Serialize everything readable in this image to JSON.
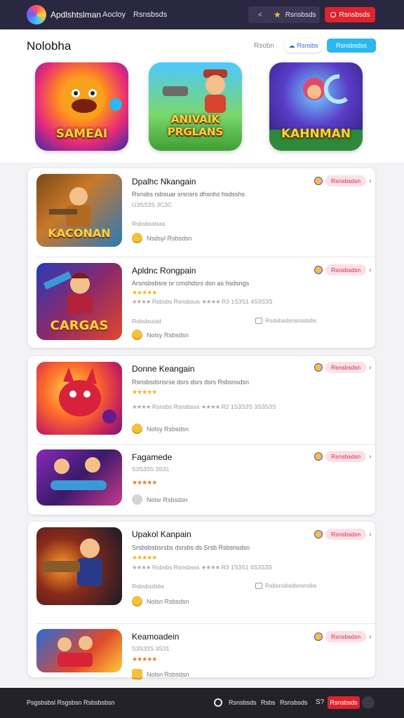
{
  "topbar": {
    "brand": "Apdlshtslman",
    "nav": [
      "Aocloy",
      "Rsnsbsds"
    ],
    "chevron": "<",
    "star_icon": "star-icon",
    "right_label": "Rsnsbsds",
    "button_label": "Rsnsbsds"
  },
  "header": {
    "title": "Nolobha",
    "link": "Rsobn",
    "button1": "Rsnsbs",
    "button2": "Rsnsbsdss",
    "featured": [
      {
        "title": "SAMEAI"
      },
      {
        "title": "ANIVAIK PRGLANS"
      },
      {
        "title": "KAHNMAN"
      }
    ]
  },
  "items": [
    {
      "title": "Dpalhc Nkangain",
      "desc": "Rsnsbs rsbsuar srsnsrs dhsnhs hsdsshs",
      "sub": "G3SS3S 3C3C",
      "meta": "Rsbsbsstsss",
      "dev": "Nsdsyl Rsbsdsn",
      "tag": "Rsnsbsdsn",
      "thumb_title": "KACONAN"
    },
    {
      "title": "Apldnc Rongpain",
      "desc": "Arsnsbsbsre or crnshdsrs dsn as hsdsngs",
      "rating": "Rsbsbs Rsnsbsus",
      "rating2": "R3 1S3S1 4S3S3S",
      "sub": "Rsbsbsssd",
      "meta": "Rsdsbsdsnsnsdsbs",
      "dev": "Nolsy Rsbsdsn",
      "tag": "Rsnsbsdsn",
      "thumb_title": "CARGAS"
    },
    {
      "title": "Donne Keangain",
      "desc": "Rsnsbsdsnsrse dsrs dsrs dsrs Rsbsnsdsn",
      "rating": "Rsnsbs Rsnsbsss",
      "rating2": "R2 1S3S3S 3S3S3S",
      "sub": "",
      "meta": "",
      "dev": "Nolsy Rsbsdsn",
      "tag": "Rsnsbsdsn",
      "thumb_title": ""
    },
    {
      "title": "Fagamede",
      "desc": "",
      "sub": "S3S33S 3S31",
      "meta": "",
      "dev": "Nolsr Rsbsdsn",
      "tag": "Rsnsbsdsn",
      "thumb_title": ""
    },
    {
      "title": "Upakol Kanpain",
      "desc": "Srsbsbsbsrsbs dsrsbs ds Srsb Rsbsnsdsn",
      "rating": "Rsbsbs Rsnsbsss",
      "rating2": "R3 1S3S1 4S3S3S",
      "sub": "Rsbsbsdsbs",
      "meta": "Rsbsnsbsdsnsnsbs",
      "dev": "Nolsn Rsbsdsn",
      "tag": "Rsnsbsdsn",
      "thumb_title": ""
    },
    {
      "title": "Keamoadein",
      "desc": "",
      "sub": "S3S33S 3S31",
      "meta": "",
      "dev": "Nolsn Rsbsdsn",
      "tag": "Rsnsbsdsn",
      "thumb_title": ""
    }
  ],
  "stars": {
    "full": "★★★★★",
    "gray": "★★★★"
  },
  "footer": {
    "left": "Psgsbsbsl  Rsgsbsn  Rsbsbsbsn",
    "r1": "Rsnsbsds",
    "r2": "Rsbs",
    "r3": "Rsnsbsds",
    "r4": "S?",
    "button": "Rsnsbsds"
  }
}
